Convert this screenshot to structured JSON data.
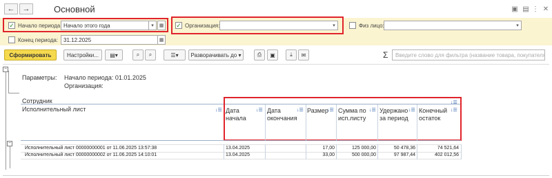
{
  "window": {
    "title": "Основной",
    "back_icon": "arrow-left-icon",
    "forward_icon": "arrow-right-icon",
    "back_glyph": "←",
    "forward_glyph": "→"
  },
  "params": {
    "period_start": {
      "label": "Начало периода:",
      "value": "Начало этого года",
      "checked": true
    },
    "period_end": {
      "label": "Конец периода:",
      "value": "31.12.2025",
      "checked": false
    },
    "organization": {
      "label": "Организация:",
      "value": "",
      "checked": true
    },
    "person": {
      "label": "Физ лицо:",
      "value": "",
      "checked": false
    }
  },
  "toolbar": {
    "generate_label": "Сформировать",
    "settings_label": "Настройки...",
    "expand_label": "Разворачивать до",
    "search_placeholder": "Введите слово для фильтра (название товара, покупателя и пр.)",
    "sigma": "Σ"
  },
  "report": {
    "params_label": "Параметры:",
    "period_line": "Начало периода: 01.01.2025",
    "org_line": "Организация:",
    "group_header": "Сотрудник",
    "col_main": "Исполнительный лист",
    "columns": [
      {
        "label": "Дата начала"
      },
      {
        "label": "Дата окончания"
      },
      {
        "label": "Размер"
      },
      {
        "label": "Сумма по исп.листу"
      },
      {
        "label": "Удержано за период"
      },
      {
        "label": "Конечный остаток"
      }
    ],
    "rows": [
      {
        "name": "Исполнительный лист 00000000001 от 11.06.2025 13:57:38",
        "start": "13.04.2025",
        "end": "",
        "size": "17,00",
        "sum": "125 000,00",
        "withheld": "50 478,36",
        "balance": "74 521,64"
      },
      {
        "name": "Исполнительный лист 00000000002 от 11.06.2025 14:10:01",
        "start": "13.04.2025",
        "end": "",
        "size": "33,00",
        "sum": "500 000,00",
        "withheld": "97 987,44",
        "balance": "402 012,56"
      }
    ]
  },
  "colors": {
    "accent": "#f5d94e",
    "highlight": "#e0232b",
    "panel": "#fbf4d0"
  }
}
